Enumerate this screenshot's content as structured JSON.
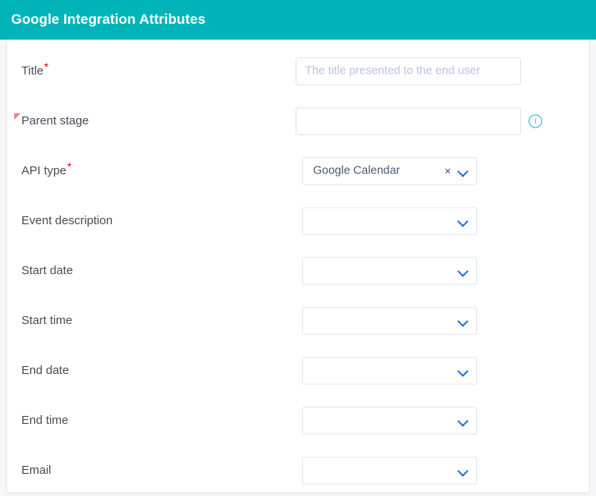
{
  "header": {
    "title": "Google Integration Attributes",
    "background_color": "#00b4ba",
    "text_color": "#ffffff"
  },
  "colors": {
    "accent_teal": "#00b4ba",
    "required_star": "#ff0000",
    "flag_marker": "#fb7a87",
    "chevron_blue": "#1f6fe0",
    "clear_icon": "#2a4a88",
    "info_icon": "#18bac4",
    "input_border": "#dfe3ee",
    "placeholder": "#b9c4dc",
    "label_text": "#4b4b57",
    "page_background": "#f7f7f9",
    "card_background": "#ffffff"
  },
  "form": {
    "rows": [
      {
        "label": "Title",
        "required": true,
        "flagged": false,
        "control": "text",
        "value": "",
        "placeholder": "The title presented to the end user",
        "info": false,
        "name": "title"
      },
      {
        "label": "Parent stage",
        "required": false,
        "flagged": true,
        "control": "text",
        "value": "",
        "placeholder": "",
        "info": true,
        "name": "parent-stage"
      },
      {
        "label": "API type",
        "required": true,
        "flagged": false,
        "control": "select",
        "value": "Google Calendar",
        "clearable": true,
        "info": false,
        "name": "api-type"
      },
      {
        "label": "Event description",
        "required": false,
        "flagged": false,
        "control": "select",
        "value": "",
        "clearable": false,
        "info": false,
        "name": "event-description"
      },
      {
        "label": "Start date",
        "required": false,
        "flagged": false,
        "control": "select",
        "value": "",
        "clearable": false,
        "info": false,
        "name": "start-date"
      },
      {
        "label": "Start time",
        "required": false,
        "flagged": false,
        "control": "select",
        "value": "",
        "clearable": false,
        "info": false,
        "name": "start-time"
      },
      {
        "label": "End date",
        "required": false,
        "flagged": false,
        "control": "select",
        "value": "",
        "clearable": false,
        "info": false,
        "name": "end-date"
      },
      {
        "label": "End time",
        "required": false,
        "flagged": false,
        "control": "select",
        "value": "",
        "clearable": false,
        "info": false,
        "name": "end-time"
      },
      {
        "label": "Email",
        "required": false,
        "flagged": false,
        "control": "select",
        "value": "",
        "clearable": false,
        "info": false,
        "name": "email"
      }
    ],
    "icons": {
      "required_star": "*",
      "clear": "×",
      "chevron_down": "chevron-down-icon",
      "info": "i"
    }
  }
}
